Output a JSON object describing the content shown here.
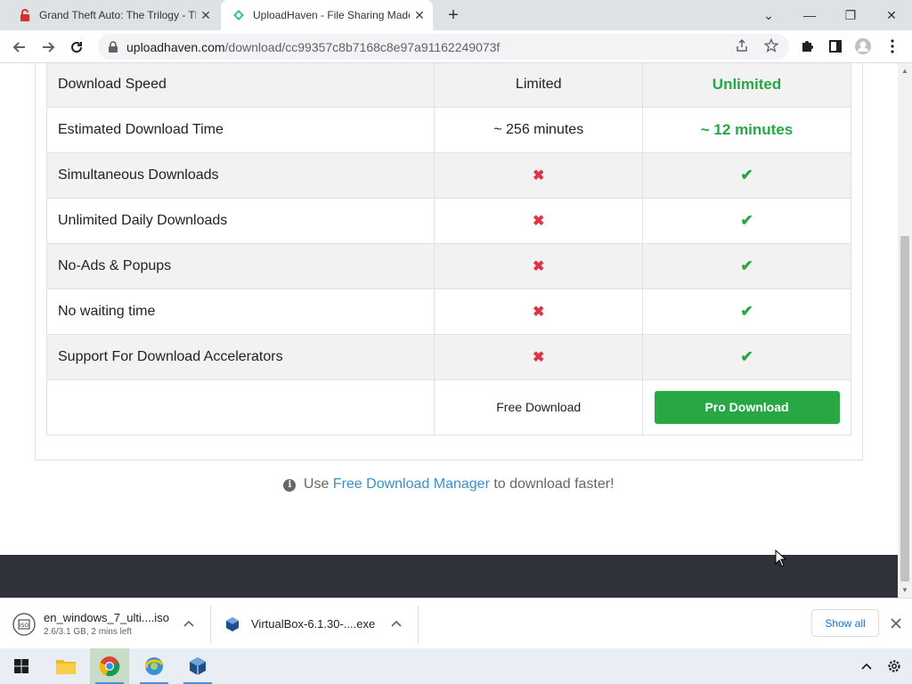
{
  "browser": {
    "tabs": [
      {
        "title": "Grand Theft Auto: The Trilogy - The Definitive Edition",
        "active": false
      },
      {
        "title": "UploadHaven - File Sharing Made Simple",
        "active": true
      }
    ],
    "url_host": "uploadhaven.com",
    "url_path": "/download/cc99357c8b7168c8e97a91162249073f"
  },
  "comparison": {
    "rows": [
      {
        "feature": "Download Speed",
        "free": "Limited",
        "pro": "Unlimited",
        "kind": "text"
      },
      {
        "feature": "Estimated Download Time",
        "free": "~ 256 minutes",
        "pro": "~ 12 minutes",
        "kind": "text"
      },
      {
        "feature": "Simultaneous Downloads",
        "kind": "icons"
      },
      {
        "feature": "Unlimited Daily Downloads",
        "kind": "icons"
      },
      {
        "feature": "No-Ads & Popups",
        "kind": "icons"
      },
      {
        "feature": "No waiting time",
        "kind": "icons"
      },
      {
        "feature": "Support For Download Accelerators",
        "kind": "icons"
      }
    ],
    "free_download_label": "Free Download",
    "pro_download_label": "Pro Download",
    "colors": {
      "pro_green": "#28a745",
      "cross_red": "#dc3545"
    }
  },
  "fdm_note": {
    "prefix": "Use",
    "link": "Free Download Manager",
    "suffix": "to download faster!"
  },
  "downloads": [
    {
      "name": "en_windows_7_ulti....iso",
      "status": "2.6/3.1 GB, 2 mins left"
    },
    {
      "name": "VirtualBox-6.1.30-....exe",
      "status": ""
    }
  ],
  "show_all_label": "Show all",
  "taskbar": {
    "apps": [
      "windows-start-icon",
      "file-explorer-icon",
      "chrome-icon",
      "browser-app-icon",
      "virtualbox-icon"
    ]
  }
}
